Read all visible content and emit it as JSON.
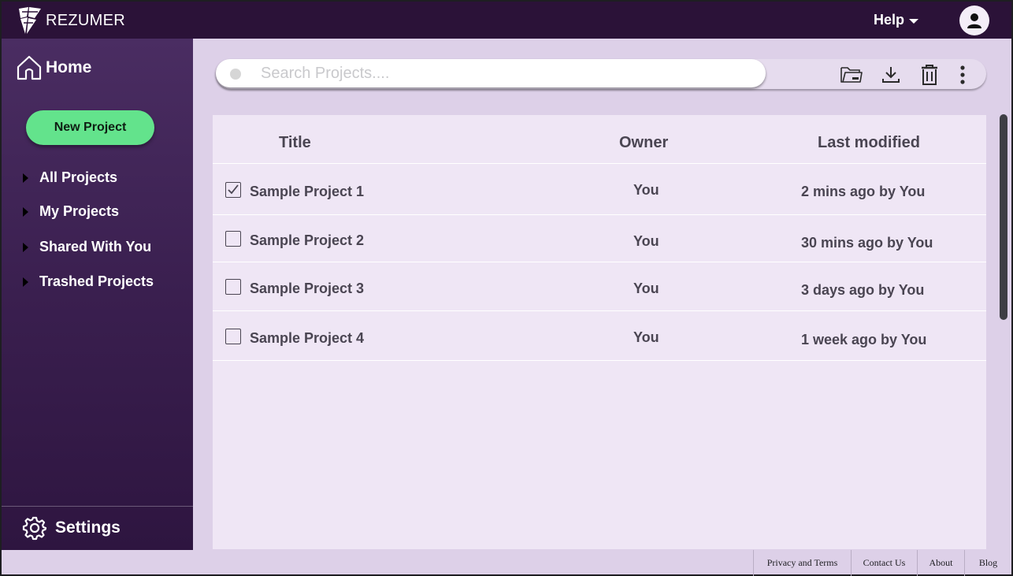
{
  "app": {
    "brand": "REZUMER"
  },
  "header": {
    "help_label": "Help"
  },
  "sidebar": {
    "home_label": "Home",
    "new_project_label": "New Project",
    "items": [
      {
        "label": "All Projects"
      },
      {
        "label": "My Projects"
      },
      {
        "label": "Shared With You"
      },
      {
        "label": "Trashed Projects"
      }
    ],
    "settings_label": "Settings"
  },
  "search": {
    "placeholder": "Search Projects...."
  },
  "toolbar": {
    "icons": [
      "folder-open-icon",
      "download-icon",
      "trash-icon",
      "more-vertical-icon"
    ]
  },
  "table": {
    "columns": {
      "title": "Title",
      "owner": "Owner",
      "modified": "Last modified"
    },
    "rows": [
      {
        "title": "Sample Project 1",
        "owner": "You",
        "modified": "2 mins ago by You",
        "checked": true
      },
      {
        "title": "Sample Project 2",
        "owner": "You",
        "modified": "30 mins ago by You",
        "checked": false
      },
      {
        "title": "Sample Project 3",
        "owner": "You",
        "modified": "3 days ago by You",
        "checked": false
      },
      {
        "title": "Sample Project 4",
        "owner": "You",
        "modified": "1 week ago by You",
        "checked": false
      }
    ]
  },
  "footer": {
    "links": [
      "Privacy and Terms",
      "Contact Us",
      "About",
      "Blog"
    ]
  },
  "colors": {
    "topbar": "#2b1238",
    "sidebar": "#3a1f4f",
    "accent_green": "#63e38c",
    "content_bg": "#ddd0e8",
    "table_bg": "#efe6f5"
  }
}
